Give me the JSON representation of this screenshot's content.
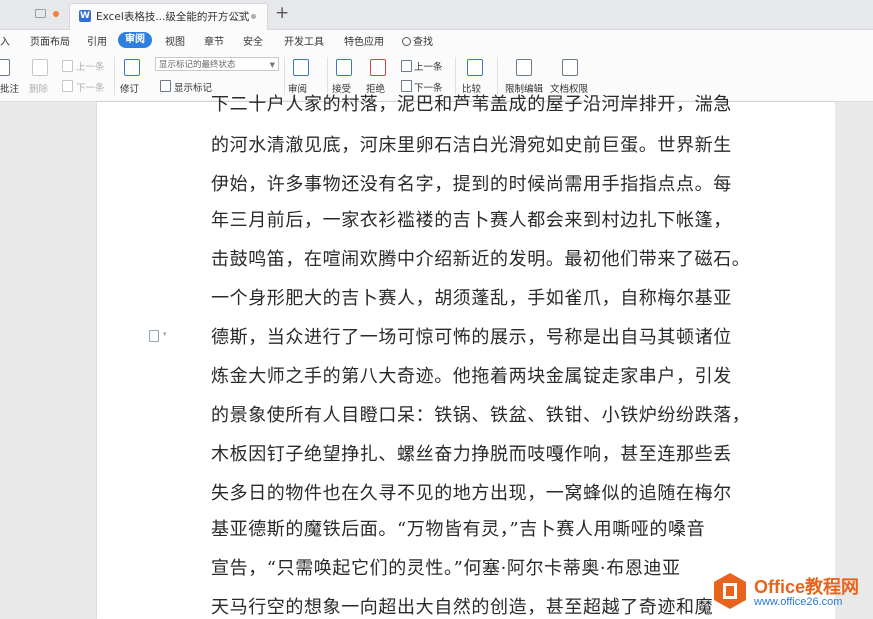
{
  "tabs": {
    "active_title": "Excel表格技...级全能的开方公式",
    "new_tab": "+"
  },
  "menu": {
    "items": [
      "入",
      "页面布局",
      "引用",
      "审阅",
      "视图",
      "章节",
      "安全",
      "开发工具",
      "特色应用"
    ],
    "active": "审阅",
    "search": "查找"
  },
  "toolbar": {
    "annotate": "批注",
    "delete": "删除",
    "prev_comment": "上一条",
    "next_comment": "下一条",
    "revise": "修订",
    "markup_select": "显示标记的最终状态",
    "show_markup": "显示标记",
    "review": "审阅",
    "accept": "接受",
    "reject": "拒绝",
    "prev_change": "上一条",
    "next_change": "下一条",
    "compare": "比较",
    "restrict_edit": "限制编辑",
    "doc_permission": "文档权限"
  },
  "document": {
    "lines": [
      "下二十户人家的村落，泥巴和芦苇盖成的屋子沿河岸排开，湍急",
      "的河水清澈见底，河床里卵石洁白光滑宛如史前巨蛋。世界新生",
      "伊始，许多事物还没有名字，提到的时候尚需用手指指点点。每",
      "年三月前后，一家衣衫褴褛的吉卜赛人都会来到村边扎下帐篷，",
      "击鼓鸣笛，在喧闹欢腾中介绍新近的发明。最初他们带来了磁石。",
      "一个身形肥大的吉卜赛人，胡须蓬乱，手如雀爪，自称梅尔基亚",
      "德斯，当众进行了一场可惊可怖的展示，号称是出自马其顿诸位",
      "炼金大师之手的第八大奇迹。他拖着两块金属锭走家串户，引发",
      "的景象使所有人目瞪口呆：铁锅、铁盆、铁钳、小铁炉纷纷跌落，",
      "木板因钉子绝望挣扎、螺丝奋力挣脱而吱嘎作响，甚至连那些丢",
      "失多日的物件也在久寻不见的地方出现，一窝蜂似的追随在梅尔",
      "基亚德斯的魔铁后面。“万物皆有灵，”吉卜赛人用嘶哑的嗓音",
      "宣告，“只需唤起它们的灵性。”何塞·阿尔卡蒂奥·布恩迪亚",
      "天马行空的想象一向超出大自然的创造，甚至超越了奇迹和魔"
    ]
  },
  "watermark": {
    "brand": "Office教程网",
    "url": "www.office26.com"
  },
  "colors": {
    "accent": "#2f7fe0",
    "brand_orange": "#e8641c",
    "brand_blue": "#2a7ad5"
  }
}
